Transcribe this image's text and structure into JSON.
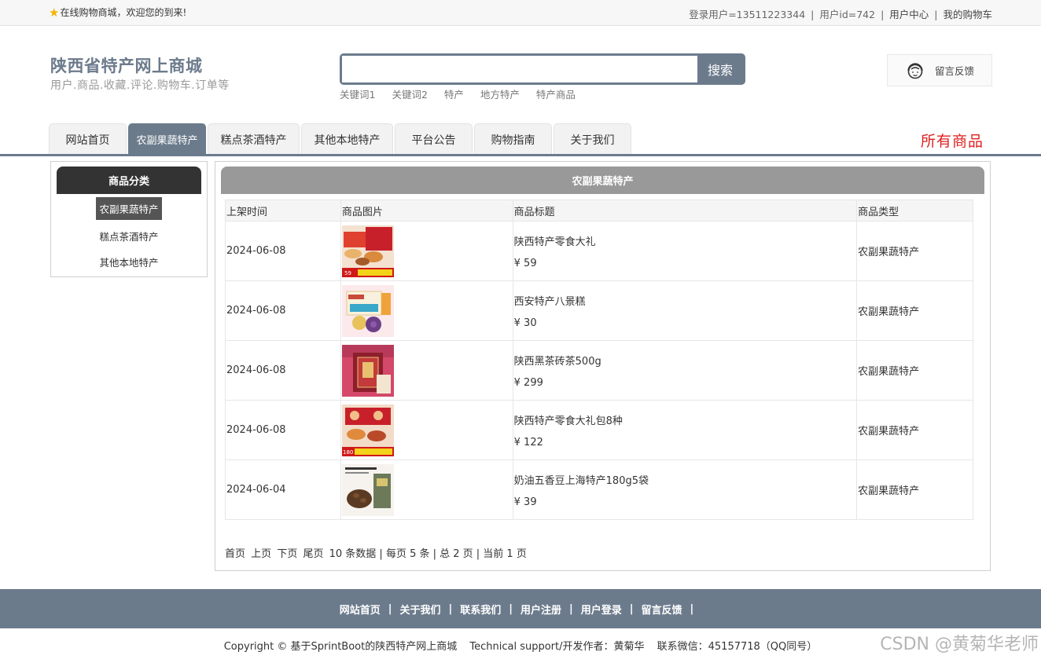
{
  "topbar": {
    "welcome": "在线购物商城，欢迎您的到来!",
    "login_user": "登录用户=13511223344",
    "user_id": "用户id=742",
    "user_center": "用户中心",
    "cart": "我的购物车",
    "separator": "|"
  },
  "header": {
    "title": "陕西省特产网上商城",
    "subtitle": "用户.商品.收藏.评论.购物车.订单等",
    "search_value": "",
    "search_button": "搜索",
    "hotwords": [
      "关键词1",
      "关键词2",
      "特产",
      "地方特产",
      "特产商品"
    ],
    "feedback": "留言反馈"
  },
  "nav": {
    "tabs": [
      {
        "label": "网站首页",
        "active": false
      },
      {
        "label": "农副果蔬特产",
        "active": true
      },
      {
        "label": "糕点茶酒特产",
        "active": false
      },
      {
        "label": "其他本地特产",
        "active": false
      },
      {
        "label": "平台公告",
        "active": false
      },
      {
        "label": "购物指南",
        "active": false
      },
      {
        "label": "关于我们",
        "active": false
      }
    ],
    "all_goods": "所有商品"
  },
  "sidebar": {
    "heading": "商品分类",
    "items": [
      {
        "label": "农副果蔬特产",
        "active": true
      },
      {
        "label": "糕点茶酒特产",
        "active": false
      },
      {
        "label": "其他本地特产",
        "active": false
      }
    ]
  },
  "main": {
    "heading": "农副果蔬特产",
    "columns": [
      "上架时间",
      "商品图片",
      "商品标题",
      "商品类型"
    ],
    "rows": [
      {
        "date": "2024-06-08",
        "title": "陕西特产零食大礼",
        "price": "¥ 59",
        "type": "农副果蔬特产",
        "image": "gift-box-red-image"
      },
      {
        "date": "2024-06-08",
        "title": "西安特产八景糕",
        "price": "¥ 30",
        "type": "农副果蔬特产",
        "image": "cake-box-image"
      },
      {
        "date": "2024-06-08",
        "title": "陕西黑茶砖茶500g",
        "price": "¥ 299",
        "type": "农副果蔬特产",
        "image": "tea-box-image"
      },
      {
        "date": "2024-06-08",
        "title": "陕西特产零食大礼包8种",
        "price": "¥ 122",
        "type": "农副果蔬特产",
        "image": "gift-bag-image"
      },
      {
        "date": "2024-06-04",
        "title": "奶油五香豆上海特产180g5袋",
        "price": "¥ 39",
        "type": "农副果蔬特产",
        "image": "beans-image"
      }
    ],
    "pager": {
      "first": "首页",
      "prev": "上页",
      "next": "下页",
      "last": "尾页",
      "summary": "10 条数据 | 每页 5 条 | 总 2 页 | 当前 1 页"
    }
  },
  "footer": {
    "links": [
      "网站首页",
      "关于我们",
      "联系我们",
      "用户注册",
      "用户登录",
      "留言反馈"
    ],
    "separator": "|",
    "copyright": "Copyright © 基于SprintBoot的陕西特产网上商城",
    "support": "Technical support/开发作者：黄菊华",
    "contact": "联系微信：45157718（QQ同号）",
    "watermark": "CSDN @黄菊华老师"
  },
  "colors": {
    "accent": "#6c7b8c",
    "highlight": "#e02020",
    "panel_head": "#999999",
    "category_head": "#333333"
  }
}
